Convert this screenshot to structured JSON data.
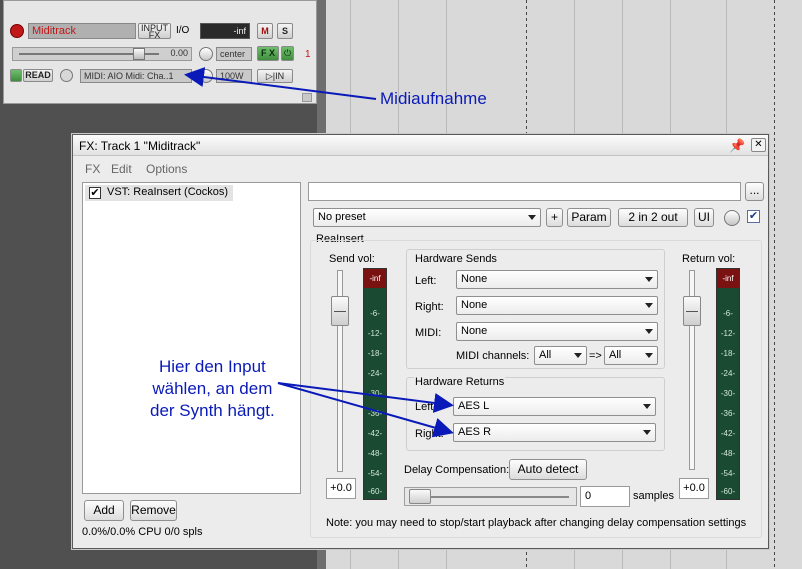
{
  "track": {
    "name": "Miditrack",
    "input_fx_label_1": "INPUT",
    "input_fx_label_2": "FX",
    "io_label": "I/O",
    "meter_value": "-inf",
    "mute_label": "M",
    "solo_label": "S",
    "volume_value": "0.00",
    "pan_value": "center",
    "fx_label": "F X",
    "track_number": "1",
    "automation_label": "READ",
    "input_value": "MIDI: AIO Midi: Cha..1",
    "width_value": "100W",
    "monitor_label": "IN"
  },
  "annotations": {
    "midi_recording": "Midiaufnahme",
    "input_hint_line1": "Hier den Input",
    "input_hint_line2": "wählen, an dem",
    "input_hint_line3": "der Synth hängt.",
    "color": "#0a1ab8"
  },
  "fx_window": {
    "title": "FX: Track 1 \"Miditrack\"",
    "menu": [
      "FX",
      "Edit",
      "Options"
    ],
    "fx_chain": [
      {
        "label": "VST: ReaInsert (Cockos)",
        "enabled": true
      }
    ],
    "add_label": "Add",
    "remove_label": "Remove",
    "cpu_label": "0.0%/0.0% CPU 0/0 spls",
    "browse_label": "...",
    "preset_value": "No preset",
    "plus_label": "+",
    "param_label": "Param",
    "io_label": "2 in 2 out",
    "ui_label": "UI",
    "plugin_name": "ReaInsert",
    "send_vol_label": "Send vol:",
    "return_vol_label": "Return vol:",
    "send_vol_value": "+0.0",
    "return_vol_value": "+0.0",
    "meter_top": "-inf",
    "meter_ticks": [
      "-6-",
      "-12-",
      "-18-",
      "-24-",
      "-30-",
      "-36-",
      "-42-",
      "-48-",
      "-54-",
      "-60-"
    ],
    "hardware_sends": {
      "title": "Hardware Sends",
      "left_label": "Left:",
      "left_value": "None",
      "right_label": "Right:",
      "right_value": "None",
      "midi_label": "MIDI:",
      "midi_value": "None",
      "midi_channels_label": "MIDI channels:",
      "midi_channels_from": "All",
      "midi_channels_arrow": "=>",
      "midi_channels_to": "All"
    },
    "hardware_returns": {
      "title": "Hardware Returns",
      "left_label": "Left:",
      "left_value": "AES L",
      "right_label": "Right:",
      "right_value": "AES R"
    },
    "delay_label": "Delay Compensation:",
    "auto_detect_label": "Auto detect",
    "delay_value": "0",
    "samples_label": "samples",
    "note": "Note: you may need to stop/start playback after changing delay compensation settings"
  }
}
